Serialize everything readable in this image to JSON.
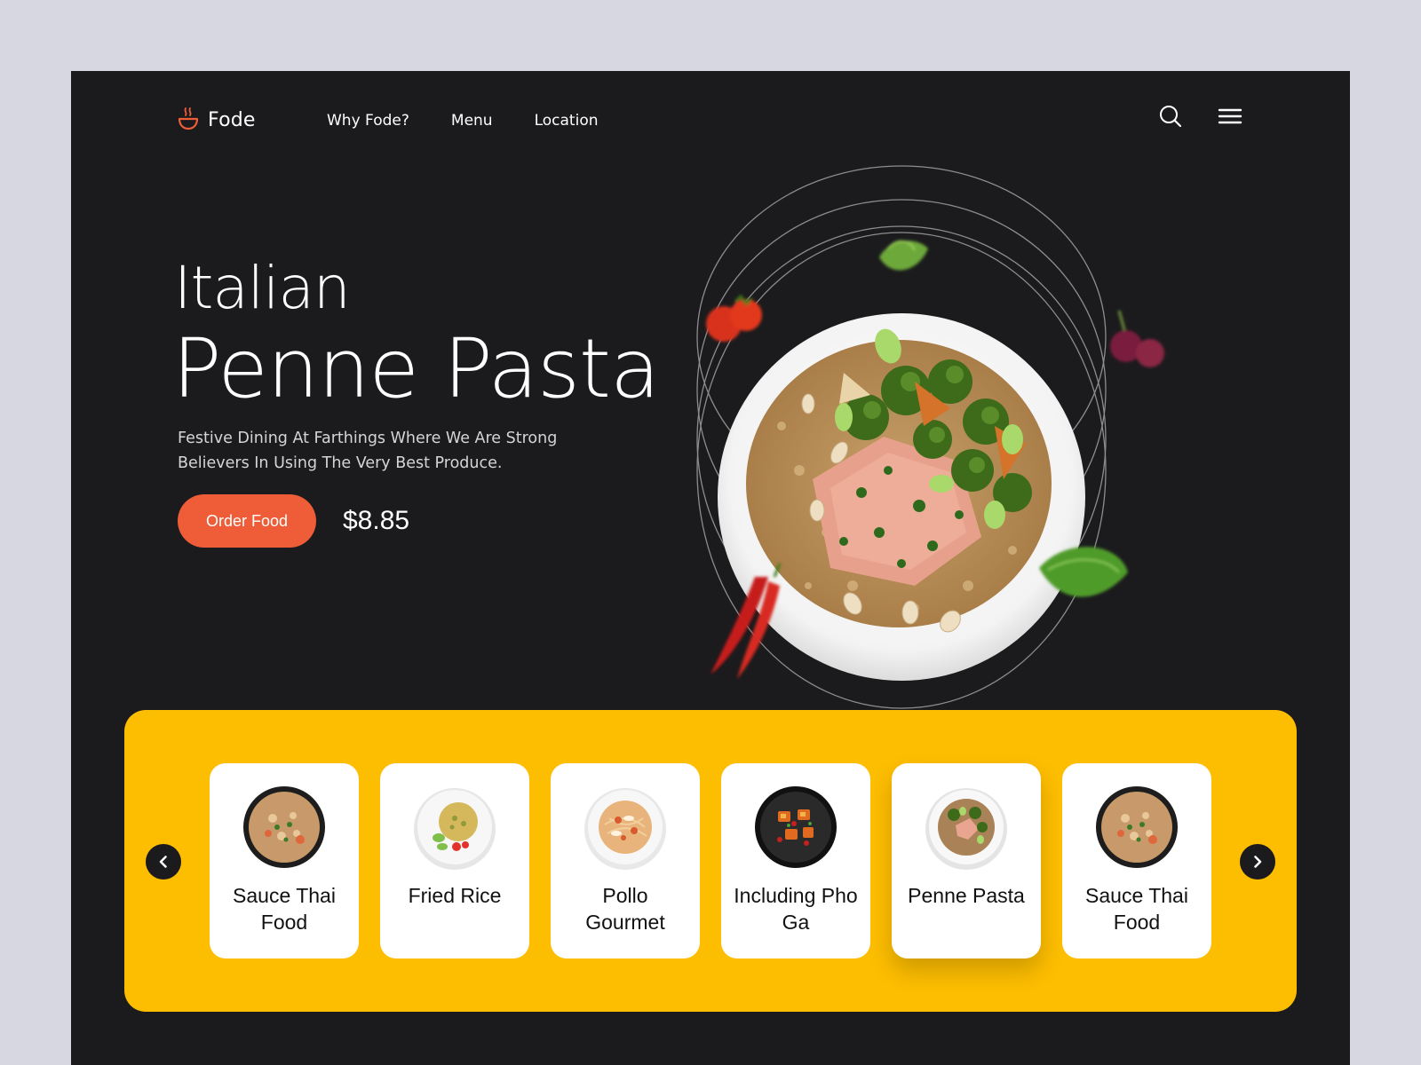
{
  "brand": {
    "name": "Fode",
    "accent": "#ee5d38"
  },
  "nav": [
    {
      "label": "Why Fode?"
    },
    {
      "label": "Menu"
    },
    {
      "label": "Location"
    }
  ],
  "header_icons": [
    "search-icon",
    "hamburger-menu-icon"
  ],
  "hero": {
    "subtitle": "Italian",
    "title": "Penne Pasta",
    "description": "Festive Dining At Farthings Where We Are Strong Believers In Using The Very Best Produce.",
    "order_label": "Order Food",
    "price": "$8.85"
  },
  "carousel": {
    "background": "#fdbd00",
    "prev_icon": "chevron-left-icon",
    "next_icon": "chevron-right-icon",
    "items": [
      {
        "name": "Sauce Thai Food",
        "active": false
      },
      {
        "name": "Fried Rice",
        "active": false
      },
      {
        "name": "Pollo Gourmet",
        "active": false
      },
      {
        "name": "Including Pho Ga",
        "active": false
      },
      {
        "name": "Penne Pasta",
        "active": true
      },
      {
        "name": "Sauce Thai Food",
        "active": false
      }
    ]
  }
}
